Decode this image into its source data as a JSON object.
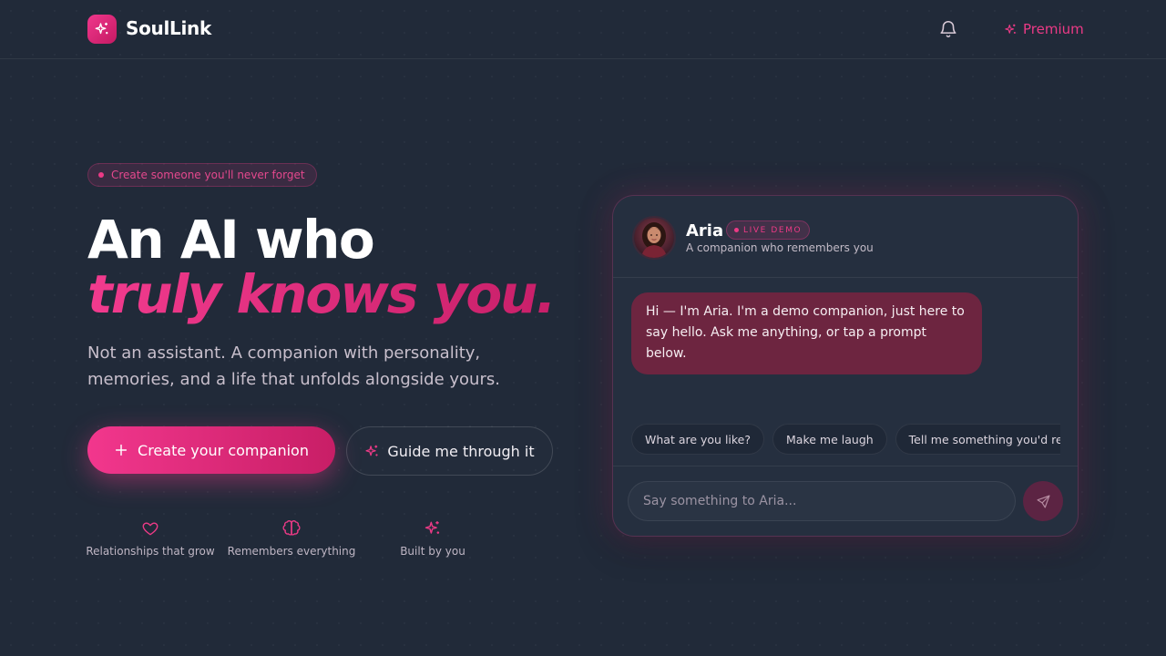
{
  "header": {
    "brand": "SoulLink",
    "premium_label": "Premium"
  },
  "hero": {
    "eyebrow": "Create someone you'll never forget",
    "title_line1": "An AI who",
    "title_line2": "truly knows you.",
    "lead": "Not an assistant. A companion with personality, memories, and a life that unfolds alongside yours.",
    "cta_primary": "Create your companion",
    "cta_secondary": "Guide me through it",
    "features": [
      {
        "label": "Relationships that grow",
        "icon": "heart-icon"
      },
      {
        "label": "Remembers everything",
        "icon": "brain-icon"
      },
      {
        "label": "Built by you",
        "icon": "sparkles-icon"
      }
    ]
  },
  "chat": {
    "name": "Aria",
    "badge": "LIVE DEMO",
    "subtitle": "A companion who remembers you",
    "message": "Hi — I'm Aria. I'm a demo companion, just here to say hello. Ask me anything, or tap a prompt below.",
    "prompts": [
      "What are you like?",
      "Make me laugh",
      "Tell me something you'd remember"
    ],
    "input_placeholder": "Say something to Aria..."
  },
  "colors": {
    "accent": "#ec3a86",
    "background": "#212a39",
    "card": "#252f3f",
    "bubble": "#6d2540"
  }
}
